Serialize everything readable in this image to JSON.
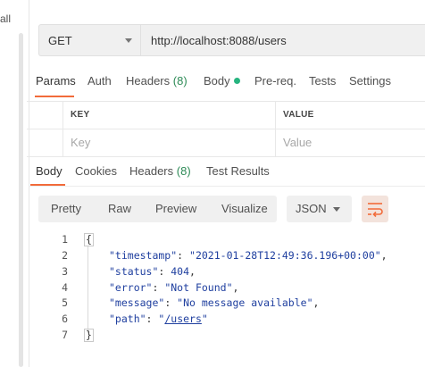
{
  "sidebar": {
    "partial_label": "all"
  },
  "request": {
    "method": "GET",
    "url": "http://localhost:8088/users",
    "tabs": [
      {
        "label": "Params"
      },
      {
        "label": "Auth"
      },
      {
        "label": "Headers",
        "count": "(8)"
      },
      {
        "label": "Body"
      },
      {
        "label": "Pre-req."
      },
      {
        "label": "Tests"
      },
      {
        "label": "Settings"
      }
    ]
  },
  "params_table": {
    "headers": [
      "KEY",
      "VALUE"
    ],
    "placeholders": [
      "Key",
      "Value"
    ]
  },
  "response": {
    "tabs": [
      {
        "label": "Body"
      },
      {
        "label": "Cookies"
      },
      {
        "label": "Headers",
        "count": "(8)"
      },
      {
        "label": "Test Results"
      }
    ],
    "view_modes": [
      "Pretty",
      "Raw",
      "Preview",
      "Visualize"
    ],
    "format": "JSON",
    "body": {
      "line_numbers": [
        "1",
        "2",
        "3",
        "4",
        "5",
        "6",
        "7"
      ],
      "open_brace": "{",
      "close_brace": "}",
      "timestamp_key": "\"timestamp\"",
      "timestamp_val": "\"2021-01-28T12:49:36.196+00:00\"",
      "status_key": "\"status\"",
      "status_val": "404",
      "error_key": "\"error\"",
      "error_val": "\"Not Found\"",
      "message_key": "\"message\"",
      "message_val": "\"No message available\"",
      "path_key": "\"path\"",
      "path_q1": "\"",
      "path_val": "/users",
      "path_q2": "\""
    }
  },
  "colors": {
    "accent": "#f26b3a",
    "count_green": "#2e8b57",
    "body_dot": "#26b47f",
    "json_blue": "#1f3f9f"
  }
}
